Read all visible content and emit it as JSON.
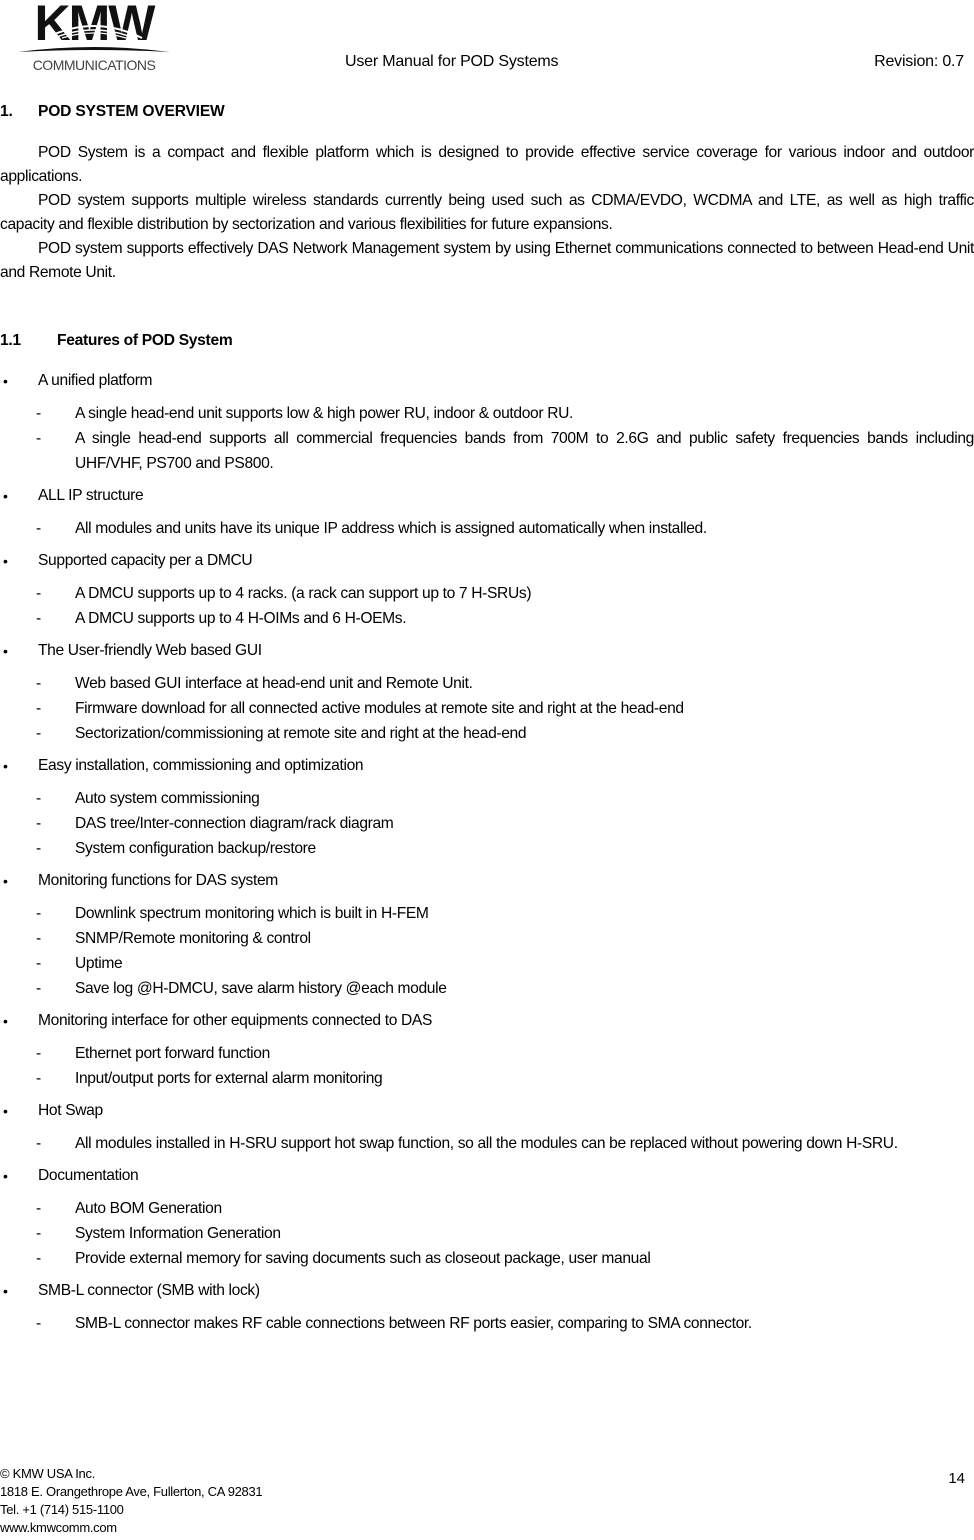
{
  "header": {
    "logo_text": "KMW",
    "logo_subtext": "COMMUNICATIONS",
    "title": "User Manual for POD Systems",
    "revision": "Revision: 0.7"
  },
  "section": {
    "number": "1.",
    "title": "POD SYSTEM OVERVIEW",
    "paragraphs": [
      "POD System is a compact and flexible platform which is designed to provide effective service coverage for various indoor and outdoor applications.",
      "POD system supports multiple wireless standards currently being used such as CDMA/EVDO, WCDMA and LTE, as well as high traffic capacity and flexible distribution by sectorization and various flexibilities for future expansions.",
      "POD system supports effectively DAS Network Management system by using Ethernet communications connected to between Head-end Unit and Remote Unit."
    ]
  },
  "subsection": {
    "number": "1.1",
    "title": "Features of POD System",
    "features": [
      {
        "label": "A unified platform",
        "items": [
          "A single head-end unit supports low & high power RU, indoor & outdoor RU.",
          "A single head-end supports all commercial frequencies bands from 700M to 2.6G and public safety frequencies bands including UHF/VHF, PS700 and PS800."
        ]
      },
      {
        "label": "ALL IP structure",
        "items": [
          "All modules and units have its unique IP address which is assigned automatically when installed."
        ]
      },
      {
        "label": "Supported capacity per a DMCU",
        "items": [
          "A DMCU supports up to 4 racks. (a rack can support up to 7 H-SRUs)",
          "A DMCU supports up to 4 H-OIMs and 6 H-OEMs."
        ]
      },
      {
        "label": "The User-friendly Web based GUI",
        "items": [
          "Web based GUI interface at head-end unit and Remote Unit.",
          "Firmware download for all connected active modules at remote site and right at the head-end",
          "Sectorization/commissioning at remote site and right at the head-end"
        ]
      },
      {
        "label": "Easy installation, commissioning and optimization",
        "items": [
          "Auto system commissioning",
          "DAS tree/Inter-connection diagram/rack diagram",
          "System configuration backup/restore"
        ]
      },
      {
        "label": "Monitoring functions for DAS system",
        "items": [
          "Downlink spectrum monitoring which is built in H-FEM",
          "SNMP/Remote monitoring & control",
          "Uptime",
          "Save log @H-DMCU, save alarm history @each module"
        ]
      },
      {
        "label": "Monitoring interface for other equipments connected to DAS",
        "items": [
          "Ethernet port forward function",
          "Input/output ports for external alarm monitoring"
        ]
      },
      {
        "label": "Hot Swap",
        "items": [
          "All modules installed in H-SRU support hot swap function, so all the modules can be replaced without powering down H-SRU."
        ]
      },
      {
        "label": "Documentation",
        "items": [
          "Auto BOM Generation",
          "System Information Generation",
          "Provide external memory for saving documents such as closeout package, user manual"
        ]
      },
      {
        "label": "SMB-L connector (SMB with lock)",
        "items": [
          "SMB-L connector makes RF cable connections between RF ports easier, comparing to SMA connector."
        ]
      }
    ]
  },
  "footer": {
    "lines": [
      "© KMW USA Inc.",
      "1818 E. Orangethrope Ave, Fullerton, CA 92831",
      "Tel. +1 (714) 515-1100",
      "www.kmwcomm.com"
    ],
    "page_number": "14"
  },
  "glyphs": {
    "bullet": "•",
    "dash": "-"
  }
}
